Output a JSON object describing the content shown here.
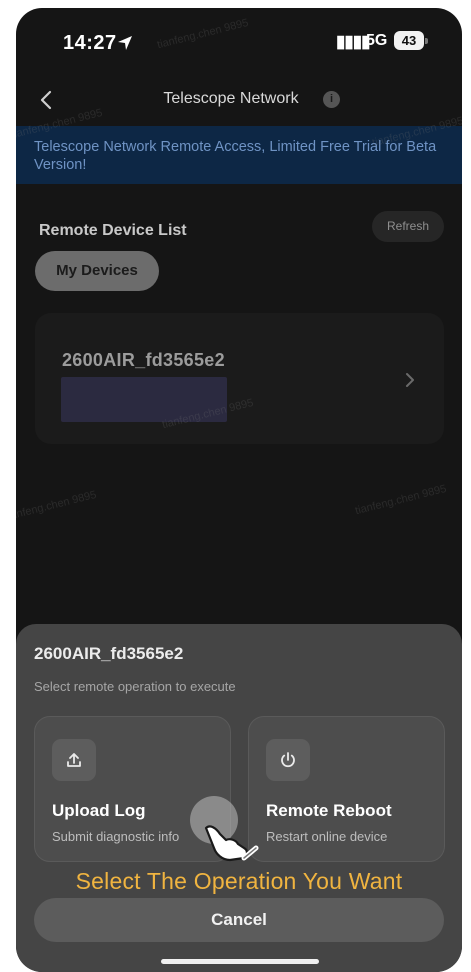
{
  "status_bar": {
    "time": "14:27",
    "network": "5G",
    "battery": "43"
  },
  "nav": {
    "title": "Telescope Network",
    "info_glyph": "i"
  },
  "banner": {
    "text": "Telescope Network Remote Access, Limited Free Trial for Beta Version!"
  },
  "device_list": {
    "title": "Remote Device List",
    "refresh_label": "Refresh",
    "filter_chip": "My Devices",
    "devices": [
      {
        "name": "2600AIR_fd3565e2"
      }
    ]
  },
  "watermark": {
    "text": "tianfeng.chen 9895"
  },
  "sheet": {
    "title": "2600AIR_fd3565e2",
    "subtitle": "Select remote operation to execute",
    "operations": [
      {
        "title": "Upload Log",
        "subtitle": "Submit diagnostic info",
        "icon": "upload-icon"
      },
      {
        "title": "Remote Reboot",
        "subtitle": "Restart online device",
        "icon": "power-icon"
      }
    ],
    "overlay_caption": "Select The Operation You Want",
    "cancel_label": "Cancel"
  },
  "colors": {
    "background": "#151515",
    "banner_bg": "#0d2745",
    "banner_text": "#6f93c4",
    "sheet_bg": "#454545",
    "caption": "#f0b440"
  }
}
